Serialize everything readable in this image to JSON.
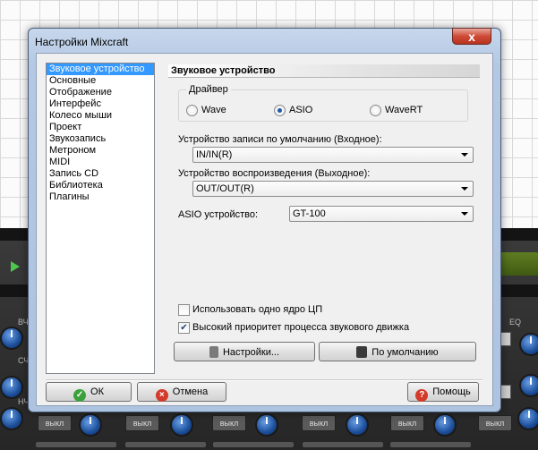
{
  "window": {
    "title": "Настройки Mixcraft",
    "close_glyph": "x"
  },
  "categories": [
    {
      "label": "Звуковое устройство",
      "selected": true
    },
    {
      "label": "Основные"
    },
    {
      "label": "Отображение"
    },
    {
      "label": "Интерфейс"
    },
    {
      "label": "Колесо мыши"
    },
    {
      "label": "Проект"
    },
    {
      "label": "Звукозапись"
    },
    {
      "label": "Метроном"
    },
    {
      "label": "MIDI"
    },
    {
      "label": "Запись CD"
    },
    {
      "label": "Библиотека"
    },
    {
      "label": "Плагины"
    }
  ],
  "panel": {
    "heading": "Звуковое устройство",
    "driver": {
      "legend": "Драйвер",
      "options": [
        {
          "label": "Wave",
          "selected": false
        },
        {
          "label": "ASIO",
          "selected": true
        },
        {
          "label": "WaveRT",
          "selected": false
        }
      ]
    },
    "record_device": {
      "label": "Устройство записи по умолчанию (Входное):",
      "value": "IN/IN(R)"
    },
    "playback_device": {
      "label": "Устройство воспроизведения (Выходное):",
      "value": "OUT/OUT(R)"
    },
    "asio_device": {
      "label": "ASIO устройство:",
      "value": "GT-100"
    },
    "single_core": {
      "label": "Использовать одно ядро ЦП",
      "checked": false
    },
    "high_priority": {
      "label": "Высокий приоритет процесса звукового движка",
      "checked": true
    },
    "settings_button": "Настройки...",
    "defaults_button": "По умолчанию"
  },
  "footer": {
    "ok": "ОК",
    "cancel": "Отмена",
    "help": "Помощь"
  },
  "background": {
    "mute_label": "выкл",
    "eq_label": "EQ",
    "track_labels": [
      "ВЧ",
      "СЧ",
      "НЧ"
    ]
  }
}
